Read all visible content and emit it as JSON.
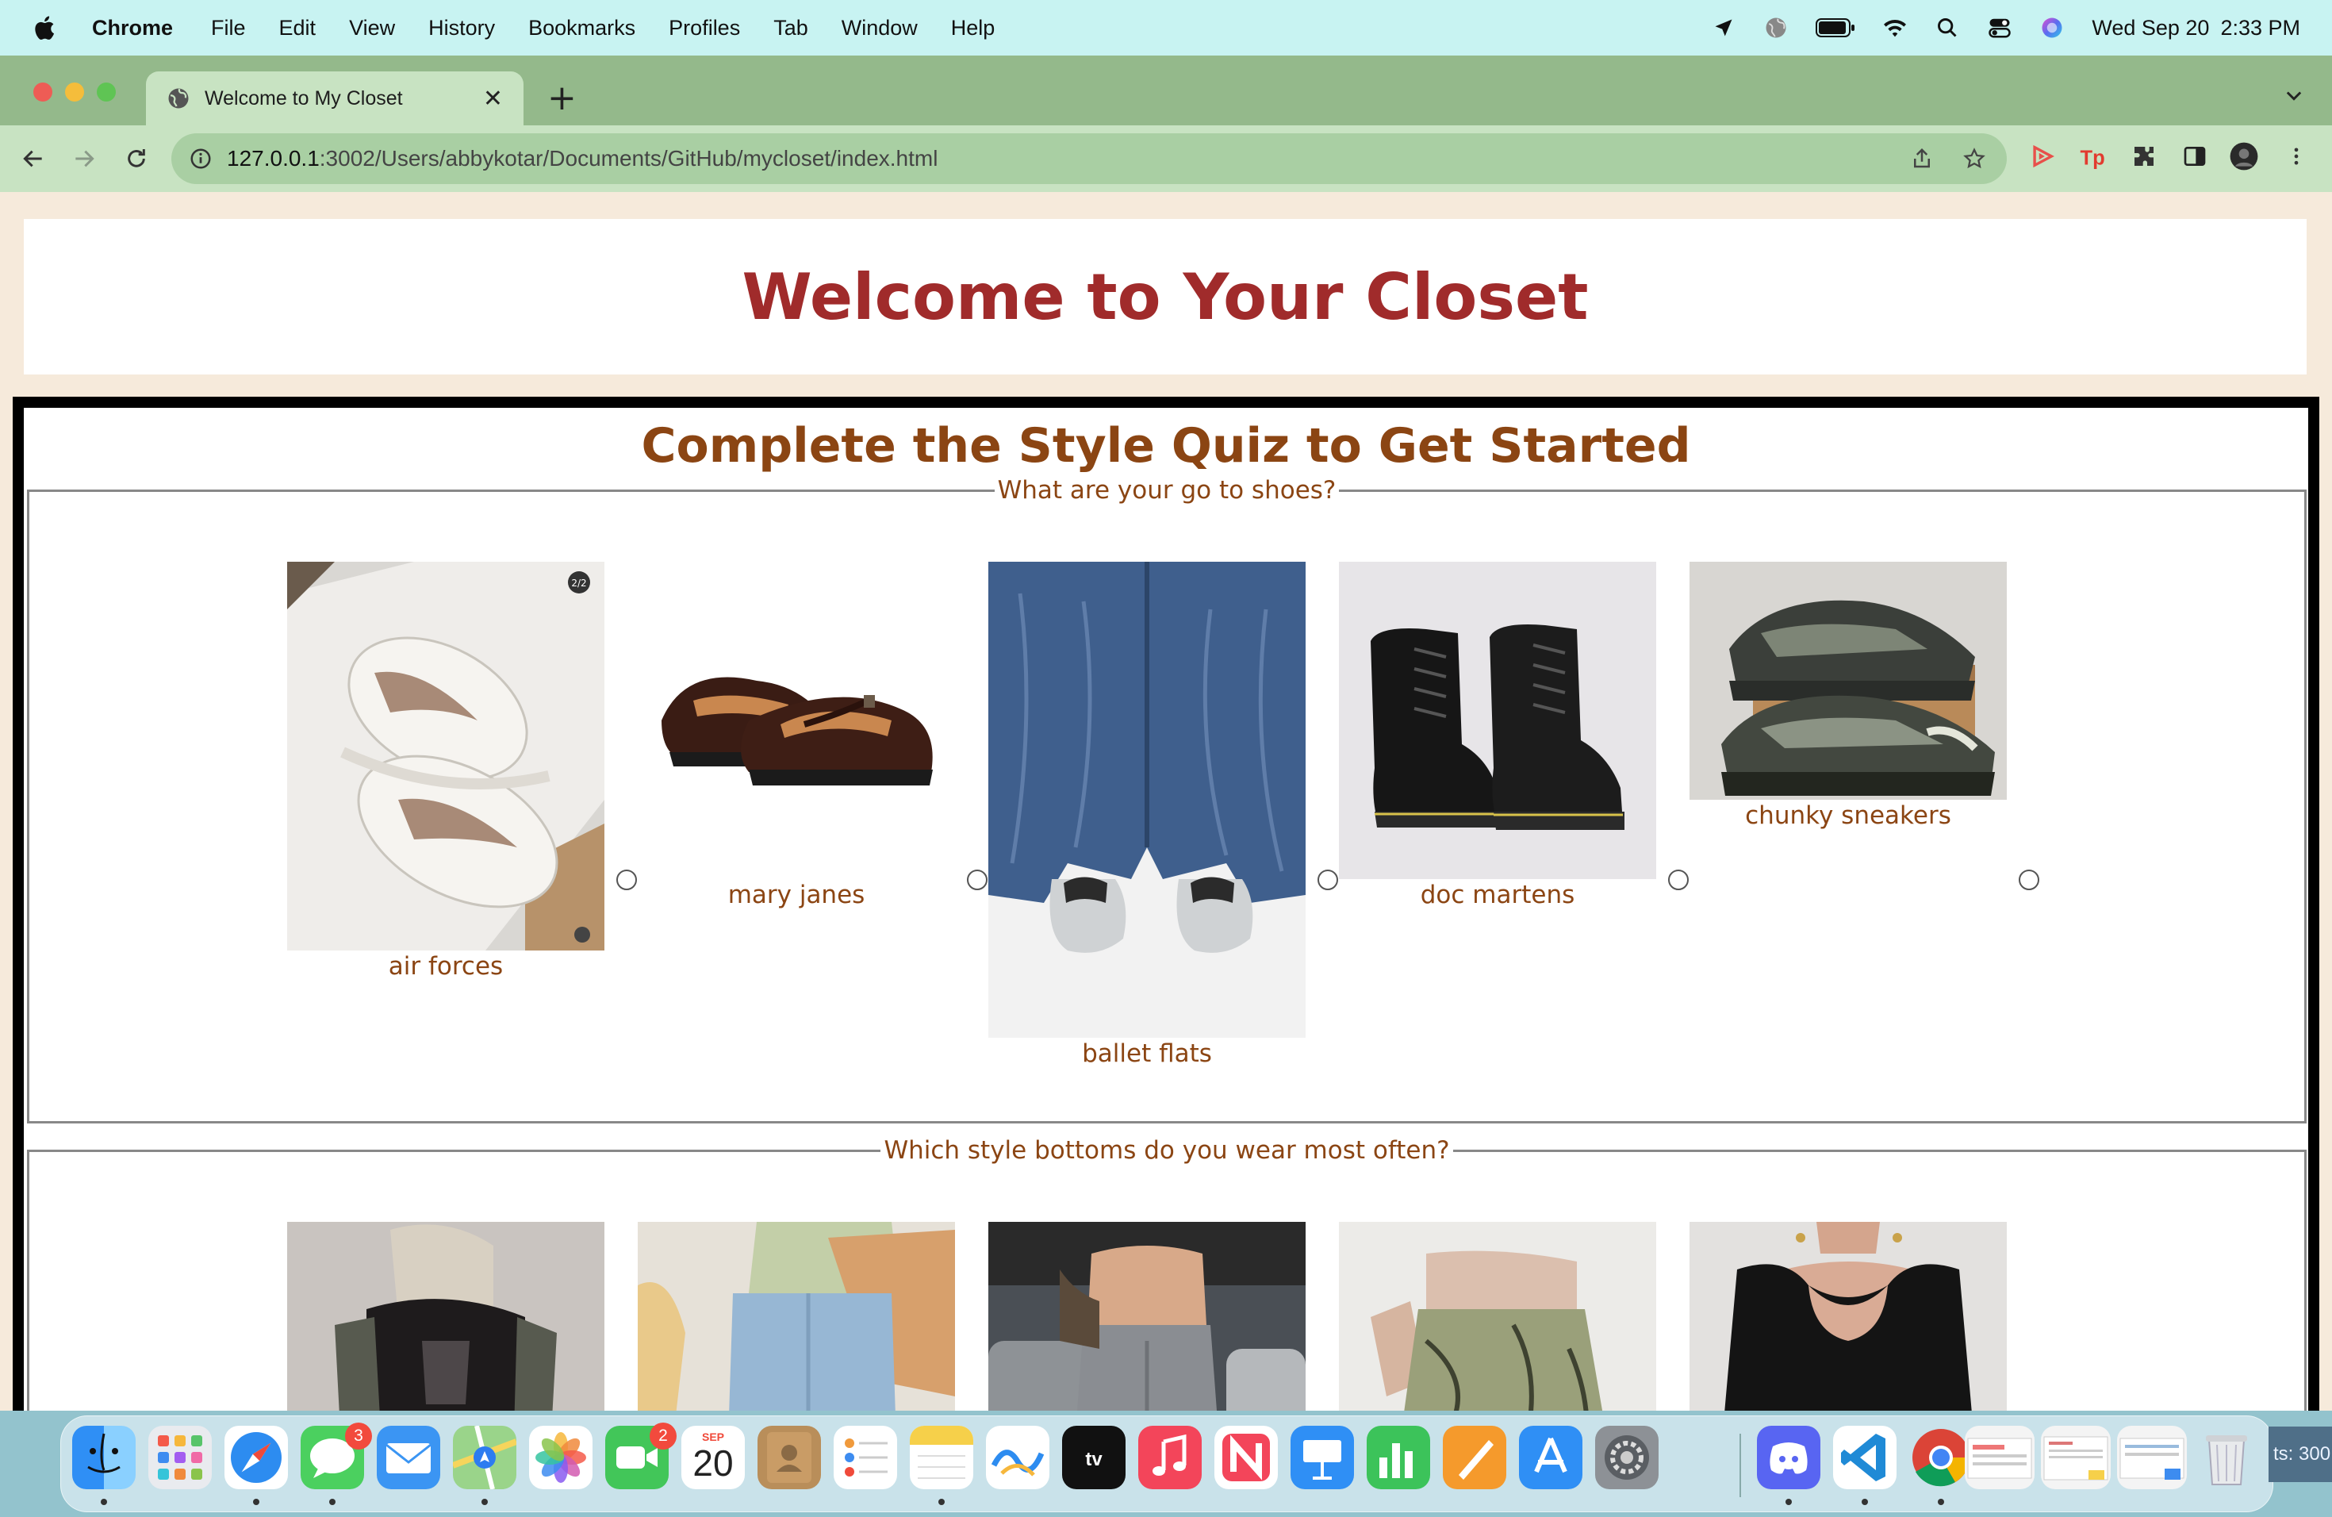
{
  "menubar": {
    "app": "Chrome",
    "items": [
      "File",
      "Edit",
      "View",
      "History",
      "Bookmarks",
      "Profiles",
      "Tab",
      "Window",
      "Help"
    ],
    "date": "Wed Sep 20",
    "time": "2:33 PM"
  },
  "browser": {
    "tab_title": "Welcome to My Closet",
    "url_host": "127.0.0.1",
    "url_rest": ":3002/Users/abbykotar/Documents/GitHub/mycloset/index.html"
  },
  "page": {
    "heading": "Welcome to Your Closet",
    "quiz_title": "Complete the Style Quiz to Get Started",
    "questions": [
      {
        "legend": "What are your go to shoes?",
        "options": [
          {
            "label": "air forces",
            "photo_badge": "2/2"
          },
          {
            "label": "mary janes"
          },
          {
            "label": "ballet flats"
          },
          {
            "label": "doc martens"
          },
          {
            "label": "chunky sneakers"
          }
        ]
      },
      {
        "legend": "Which style bottoms do you wear most often?",
        "options": [
          {
            "label": ""
          },
          {
            "label": ""
          },
          {
            "label": ""
          },
          {
            "label": ""
          },
          {
            "label": ""
          }
        ]
      }
    ]
  },
  "dock": {
    "messages_badge": "3",
    "facetime_badge": "2",
    "calendar_month": "SEP",
    "calendar_day": "20",
    "clipped_text": "ts: 300"
  }
}
